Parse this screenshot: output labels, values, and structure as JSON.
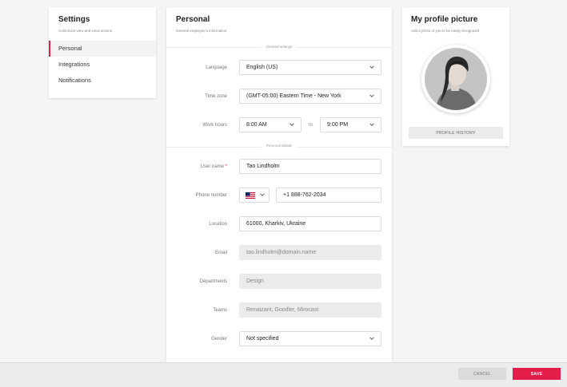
{
  "settings": {
    "title": "Settings",
    "subtitle": "Customize view and extra actions",
    "items": [
      {
        "label": "Personal",
        "active": true
      },
      {
        "label": "Integrations",
        "active": false
      },
      {
        "label": "Notifications",
        "active": false
      }
    ]
  },
  "personal": {
    "title": "Personal",
    "subtitle": "General employee's information",
    "general_section": "General settings",
    "personal_section": "Personal details",
    "language": {
      "label": "Language",
      "value": "English (US)"
    },
    "timezone": {
      "label": "Time zone",
      "value": "(GMT-05:00) Eastern Time - New York"
    },
    "work_hours": {
      "label": "Work hours",
      "from": "8:00 AM",
      "to_label": "to",
      "to": "9:00 PM"
    },
    "user_name": {
      "label": "User name",
      "required_mark": "*",
      "value": "Tao Lindholm"
    },
    "phone": {
      "label": "Phone number",
      "country": "us-flag-icon",
      "value": "+1 888-762-2034"
    },
    "location": {
      "label": "Location",
      "value": "61000, Kharkiv, Ukraine"
    },
    "email": {
      "label": "Email",
      "placeholder": "tao.lindholm@domain.name"
    },
    "departments": {
      "label": "Departments",
      "placeholder": "Design"
    },
    "teams": {
      "label": "Teams",
      "placeholder": "Renaizant, Goodler, Mirocast"
    },
    "gender": {
      "label": "Gender",
      "value": "Not specified"
    }
  },
  "picture": {
    "title": "My profile picture",
    "subtitle": "Add a photo of you to be easily recognized",
    "history_button": "PROFILE HISTORY"
  },
  "footer": {
    "cancel_label": "CANCEL",
    "save_label": "SAVE"
  },
  "colors": {
    "accent": "#e41e4b",
    "background": "#f5f5f5",
    "card": "#ffffff"
  }
}
